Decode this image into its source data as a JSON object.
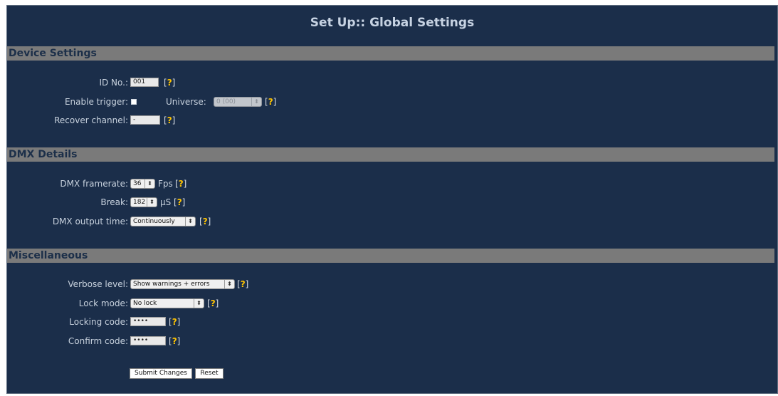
{
  "page_title": "Set Up:: Global Settings",
  "sections": {
    "device": {
      "header": "Device Settings",
      "id_no": {
        "label": "ID No.:",
        "value": "001",
        "help": "?"
      },
      "enable_trigger": {
        "label": "Enable trigger:",
        "checked": true,
        "help": "?"
      },
      "universe": {
        "label": "Universe:",
        "value": "0 (00)",
        "disabled": true,
        "help": "?"
      },
      "recover_channel": {
        "label": "Recover channel:",
        "value": "-",
        "help": "?"
      }
    },
    "dmx": {
      "header": "DMX Details",
      "framerate": {
        "label": "DMX framerate:",
        "value": "36",
        "unit": "Fps",
        "help": "?"
      },
      "break": {
        "label": "Break:",
        "value": "182",
        "unit": "µS",
        "help": "?"
      },
      "output_time": {
        "label": "DMX output time:",
        "value": "Continuously",
        "help": "?"
      }
    },
    "misc": {
      "header": "Miscellaneous",
      "verbose_level": {
        "label": "Verbose level:",
        "value": "Show warnings + errors",
        "help": "?"
      },
      "lock_mode": {
        "label": "Lock mode:",
        "value": "No lock",
        "help": "?"
      },
      "locking_code": {
        "label": "Locking code:",
        "value": "••••",
        "help": "?"
      },
      "confirm_code": {
        "label": "Confirm code:",
        "value": "••••",
        "help": "?"
      }
    }
  },
  "buttons": {
    "submit": "Submit Changes",
    "reset": "Reset"
  },
  "colors": {
    "background": "#1b2e4a",
    "section_header_bg": "#7a7a7a",
    "section_header_text": "#1c2f49",
    "help_marker": "#ffc400",
    "text": "#c8d2de"
  }
}
